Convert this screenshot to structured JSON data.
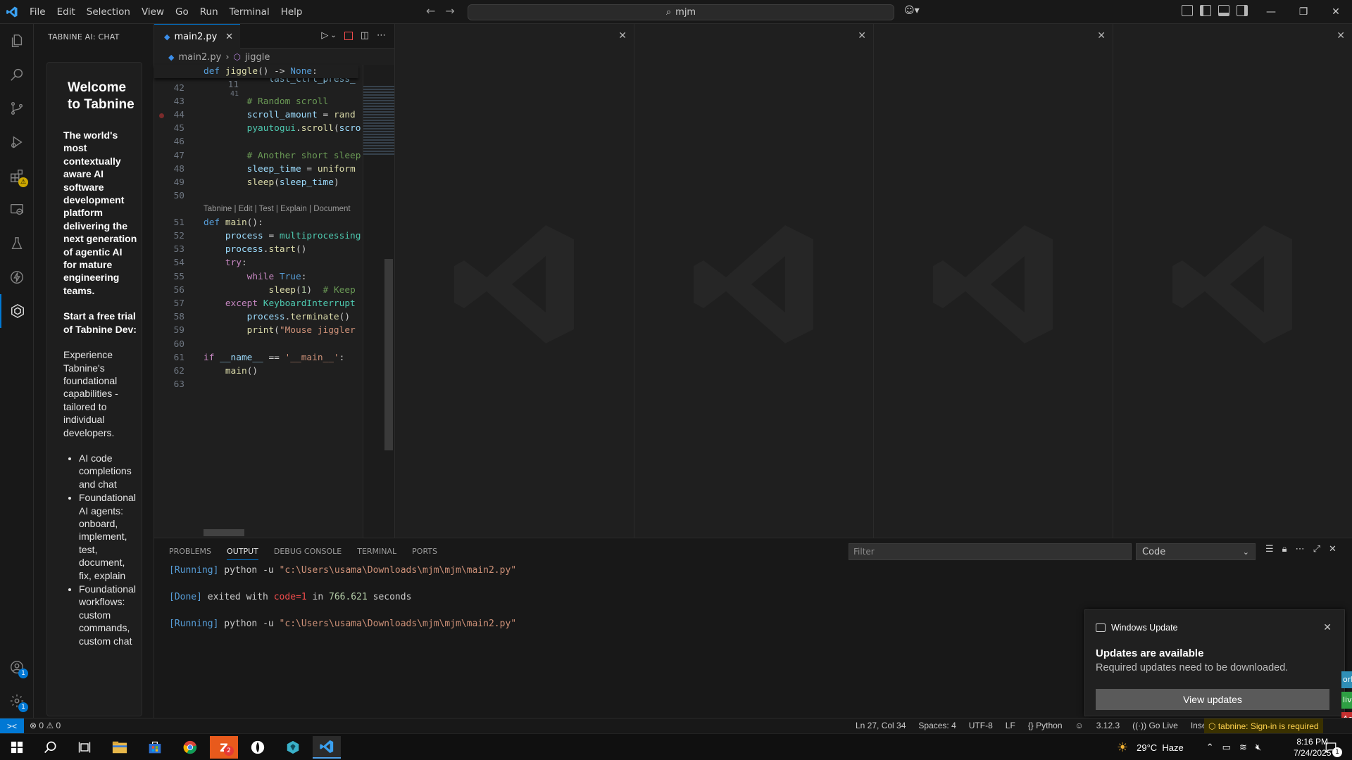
{
  "titlebar": {
    "menu": [
      "File",
      "Edit",
      "Selection",
      "View",
      "Go",
      "Run",
      "Terminal",
      "Help"
    ],
    "search_text": "mjm"
  },
  "sidebar": {
    "title": "TABNINE AI: CHAT",
    "welcome_title": "Welcome to Tabnine",
    "tagline": "The world's most contextually aware AI software development platform delivering the next generation of agentic AI for mature engineering teams.",
    "trial_heading": "Start a free trial of Tabnine Dev:",
    "trial_text": "Experience Tabnine's foundational capabilities - tailored to individual developers.",
    "features": [
      "AI code completions and chat",
      "Foundational AI agents: onboard, implement, test, document, fix, explain",
      "Foundational workflows: custom commands, custom chat"
    ]
  },
  "activity_bar": {
    "items": [
      "files-icon",
      "search-icon",
      "source-control-icon",
      "run-debug-icon",
      "extensions-icon",
      "remote-explorer-icon",
      "testing-icon",
      "lightning-icon",
      "tabnine-icon"
    ],
    "account_badge": "1",
    "settings_badge": "1"
  },
  "editor": {
    "tab_label": "main2.py",
    "breadcrumb_file": "main2.py",
    "breadcrumb_symbol": "jiggle",
    "codelens": "Tabnine | Edit | Test | Explain | Document",
    "lines": [
      {
        "n": "11",
        "t": "def jiggle() -> None:"
      },
      {
        "n": "41",
        "t": "            last_ctrl_press_"
      },
      {
        "n": "42",
        "t": ""
      },
      {
        "n": "43",
        "t": "        # Random scroll"
      },
      {
        "n": "44",
        "t": "        scroll_amount = rand"
      },
      {
        "n": "45",
        "t": "        pyautogui.scroll(scro"
      },
      {
        "n": "46",
        "t": ""
      },
      {
        "n": "47",
        "t": "        # Another short sleep"
      },
      {
        "n": "48",
        "t": "        sleep_time = uniform"
      },
      {
        "n": "49",
        "t": "        sleep(sleep_time)"
      },
      {
        "n": "50",
        "t": ""
      },
      {
        "n": "51",
        "t": "def main():"
      },
      {
        "n": "52",
        "t": "    process = multiprocessing"
      },
      {
        "n": "53",
        "t": "    process.start()"
      },
      {
        "n": "54",
        "t": "    try:"
      },
      {
        "n": "55",
        "t": "        while True:"
      },
      {
        "n": "56",
        "t": "            sleep(1)  # Keep"
      },
      {
        "n": "57",
        "t": "    except KeyboardInterrupt"
      },
      {
        "n": "58",
        "t": "        process.terminate()"
      },
      {
        "n": "59",
        "t": "        print(\"Mouse jiggler"
      },
      {
        "n": "60",
        "t": ""
      },
      {
        "n": "61",
        "t": "if __name__ == '__main__':"
      },
      {
        "n": "62",
        "t": "    main()"
      },
      {
        "n": "63",
        "t": ""
      }
    ]
  },
  "panel": {
    "tabs": [
      "PROBLEMS",
      "OUTPUT",
      "DEBUG CONSOLE",
      "TERMINAL",
      "PORTS"
    ],
    "active_tab": "OUTPUT",
    "filter_placeholder": "Filter",
    "channel": "Code",
    "output": {
      "run1_tag": "[Running]",
      "run1_cmd": " python -u ",
      "run1_path": "\"c:\\Users\\usama\\Downloads\\mjm\\mjm\\main2.py\"",
      "done_tag": "[Done]",
      "done_text1": " exited with ",
      "done_code": "code=1",
      "done_text2": " in ",
      "done_secs": "766.621",
      "done_text3": " seconds",
      "run2_tag": "[Running]",
      "run2_cmd": " python -u ",
      "run2_path": "\"c:\\Users\\usama\\Downloads\\mjm\\mjm\\main2.py\""
    }
  },
  "notification": {
    "source": "Windows Update",
    "title": "Updates are available",
    "body": "Required updates need to be downloaded.",
    "button": "View updates",
    "edge_tabs": [
      "ork",
      "live",
      "Act"
    ]
  },
  "statusbar": {
    "errors": "0",
    "warnings": "0",
    "position": "Ln 27, Col 34",
    "spaces": "Spaces: 4",
    "encoding": "UTF-8",
    "eol": "LF",
    "language": "Python",
    "python_version": "3.12.3",
    "golive": "Go Live",
    "mode": "Insert",
    "tabnine": "tabnine: Sign-in is required"
  },
  "taskbar": {
    "weather": "29°C  Haze",
    "time": "8:16 PM",
    "date": "7/24/2025",
    "notification_count": "1",
    "zoom_badge": "2"
  }
}
